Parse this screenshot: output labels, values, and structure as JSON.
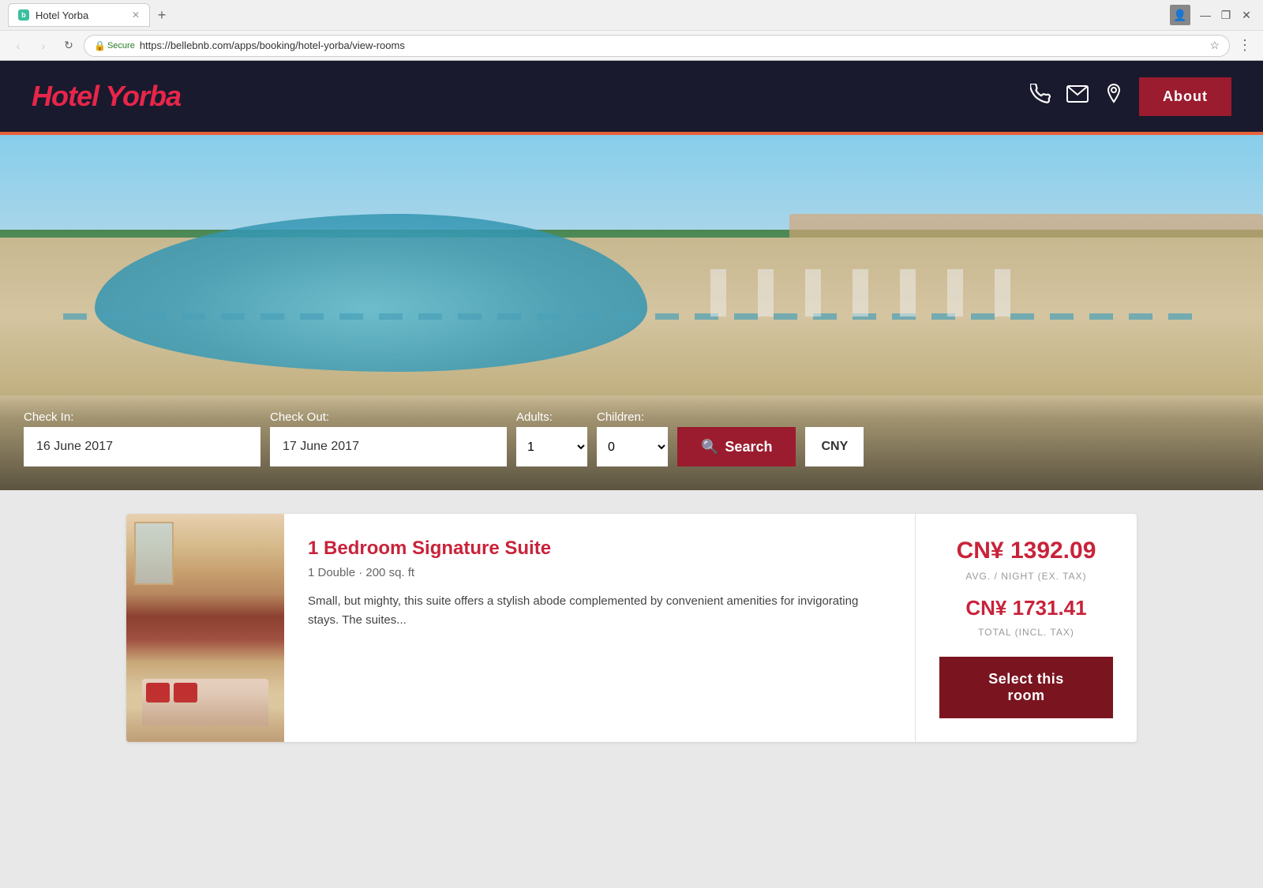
{
  "browser": {
    "tab_title": "Hotel Yorba",
    "tab_new_icon": "+",
    "nav_back": "‹",
    "nav_forward": "›",
    "nav_refresh": "↻",
    "secure_label": "Secure",
    "url": "https://bellebnb.com/apps/booking/hotel-yorba/view-rooms",
    "bookmark_icon": "☆",
    "menu_icon": "⋮",
    "window_minimize": "—",
    "window_maximize": "❐",
    "window_close": "✕"
  },
  "header": {
    "logo": "Hotel Yorba",
    "phone_icon": "📞",
    "email_icon": "✉",
    "location_icon": "📍",
    "about_label": "About"
  },
  "search": {
    "checkin_label": "Check In:",
    "checkin_value": "16 June 2017",
    "checkout_label": "Check Out:",
    "checkout_value": "17 June 2017",
    "adults_label": "Adults:",
    "adults_value": "1",
    "children_label": "Children:",
    "children_value": "0",
    "search_label": "Search",
    "search_icon": "🔍",
    "currency": "CNY"
  },
  "rooms": [
    {
      "name": "1 Bedroom Signature Suite",
      "specs": "1 Double · 200 sq. ft",
      "description": "Small, but mighty, this suite offers a stylish abode complemented by convenient amenities for invigorating stays. The suites...",
      "price_per_night": "CN¥ 1392.09",
      "price_label": "AVG. / NIGHT (EX. TAX)",
      "total_price": "CN¥ 1731.41",
      "total_label": "TOTAL (INCL. TAX)",
      "select_label": "Select this room"
    }
  ]
}
